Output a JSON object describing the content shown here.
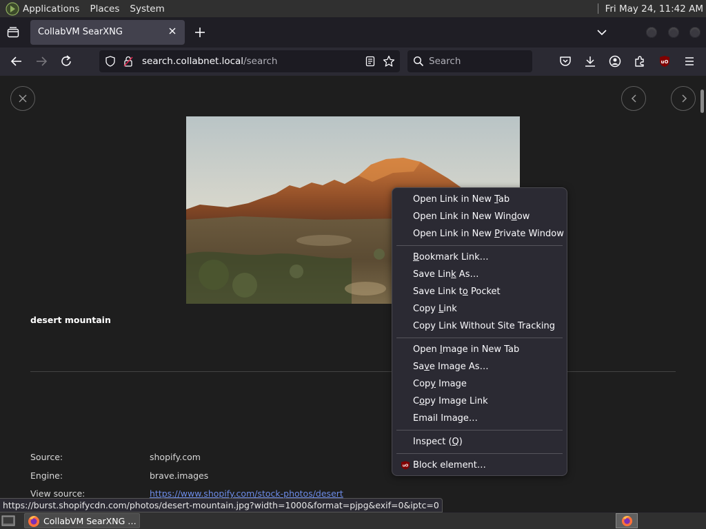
{
  "top_panel": {
    "menus": [
      "Applications",
      "Places",
      "System"
    ],
    "clock": "Fri May 24, 11:42 AM"
  },
  "tabs": {
    "active_title": "CollabVM SearXNG"
  },
  "navbar": {
    "url_host": "search.collabnet.local",
    "url_path": "/search",
    "search_placeholder": "Search"
  },
  "detail": {
    "title": "desert mountain",
    "fields": [
      {
        "label": "Source:",
        "value": "shopify.com"
      },
      {
        "label": "Engine:",
        "value": "brave.images"
      },
      {
        "label": "View source:",
        "value": "https://www.shopify.com/stock-photos/desert"
      }
    ]
  },
  "status_url": "https://burst.shopifycdn.com/photos/desert-mountain.jpg?width=1000&format=pjpg&exif=0&iptc=0",
  "context_menu": {
    "groups": [
      [
        {
          "pre": "Open Link in New ",
          "acc": "T",
          "post": "ab"
        },
        {
          "pre": "Open Link in New Win",
          "acc": "d",
          "post": "ow"
        },
        {
          "pre": "Open Link in New ",
          "acc": "P",
          "post": "rivate Window"
        }
      ],
      [
        {
          "pre": "",
          "acc": "B",
          "post": "ookmark Link…"
        },
        {
          "pre": "Save Lin",
          "acc": "k",
          "post": " As…"
        },
        {
          "pre": "Save Link t",
          "acc": "o",
          "post": " Pocket"
        },
        {
          "pre": "Copy ",
          "acc": "L",
          "post": "ink"
        },
        {
          "pre": "Copy Link Without Site Tracking",
          "acc": "",
          "post": ""
        }
      ],
      [
        {
          "pre": "Open ",
          "acc": "I",
          "post": "mage in New Tab"
        },
        {
          "pre": "Sa",
          "acc": "v",
          "post": "e Image As…"
        },
        {
          "pre": "Cop",
          "acc": "y",
          "post": " Image"
        },
        {
          "pre": "C",
          "acc": "o",
          "post": "py Image Link"
        },
        {
          "pre": "Email Image…",
          "acc": "",
          "post": ""
        }
      ],
      [
        {
          "pre": "Inspect (",
          "acc": "Q",
          "post": ")"
        }
      ],
      [
        {
          "pre": "Block element…",
          "acc": "",
          "post": "",
          "icon": "ublock-icon"
        }
      ]
    ]
  },
  "taskbar": {
    "window_label": "CollabVM SearXNG …"
  },
  "colors": {
    "ublock_red": "#800000",
    "link": "#6d8ce8",
    "firefox_orange": "#ff7139"
  }
}
